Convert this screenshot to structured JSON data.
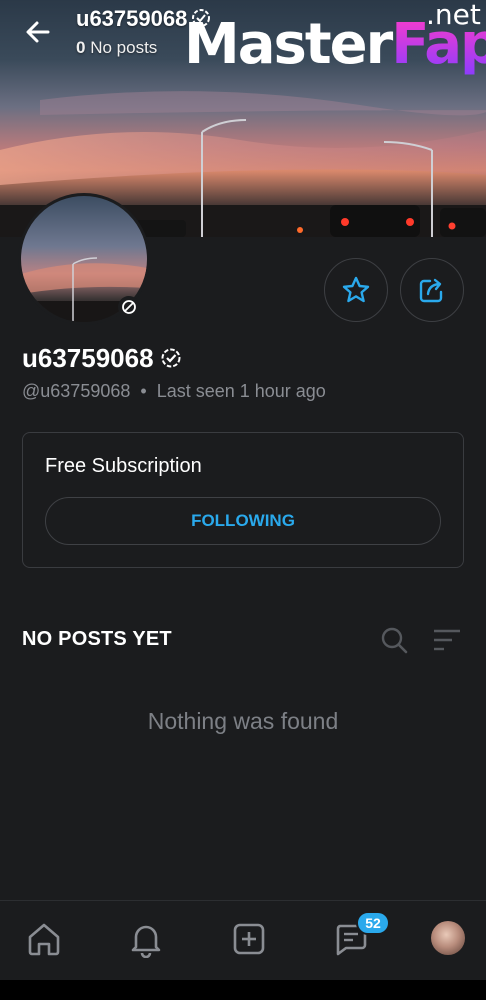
{
  "header": {
    "username": "u63759068",
    "posts_count": "0",
    "posts_label": "No posts"
  },
  "watermark": {
    "part1": "Master",
    "part2": "Fap",
    "suffix": ".net"
  },
  "profile": {
    "display_name": "u63759068",
    "handle": "@u63759068",
    "separator": "•",
    "last_seen": "Last seen 1 hour ago"
  },
  "subscription": {
    "title": "Free Subscription",
    "button_label": "FOLLOWING"
  },
  "posts": {
    "section_title": "NO POSTS YET",
    "empty_message": "Nothing was found"
  },
  "bottom_nav": {
    "items": [
      "home-icon",
      "bell-icon",
      "add-post-icon",
      "messages-icon",
      "avatar"
    ],
    "messages_badge": "52"
  },
  "colors": {
    "accent": "#2aa9ec",
    "background": "#1b1c1e",
    "muted_text": "#8a8d93",
    "border": "#3a3c40"
  }
}
